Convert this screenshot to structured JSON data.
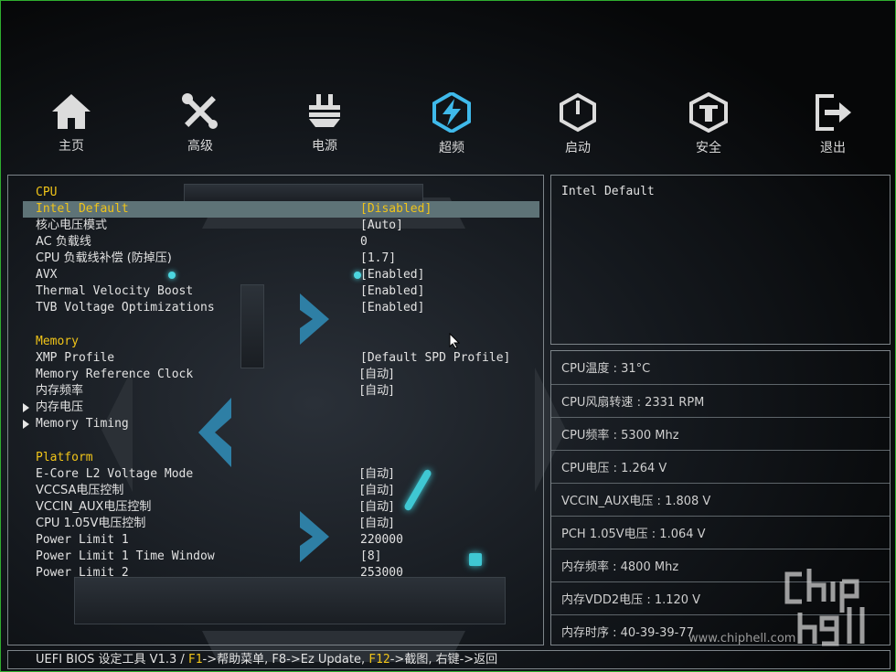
{
  "nav": [
    {
      "label": "主页",
      "icon": "home-icon"
    },
    {
      "label": "高级",
      "icon": "tools-icon"
    },
    {
      "label": "电源",
      "icon": "power-plug-icon"
    },
    {
      "label": "超频",
      "icon": "overclock-bolt-icon"
    },
    {
      "label": "启动",
      "icon": "power-button-icon"
    },
    {
      "label": "安全",
      "icon": "security-shield-icon"
    },
    {
      "label": "退出",
      "icon": "exit-icon"
    }
  ],
  "nav_active_index": 3,
  "settings": {
    "cpu_header": "CPU",
    "cpu": [
      {
        "label": "Intel Default",
        "value": "[Disabled]"
      },
      {
        "label": "核心电压模式",
        "value": "[Auto]"
      },
      {
        "label": "AC 负载线",
        "value": "0"
      },
      {
        "label": "CPU 负载线补偿 (防掉压)",
        "value": "[1.7]"
      },
      {
        "label": "AVX",
        "value": "[Enabled]"
      },
      {
        "label": "Thermal Velocity Boost",
        "value": "[Enabled]"
      },
      {
        "label": "TVB Voltage Optimizations",
        "value": "[Enabled]"
      }
    ],
    "memory_header": "Memory",
    "memory": [
      {
        "label": "XMP Profile",
        "value": "[Default SPD Profile]"
      },
      {
        "label": "Memory Reference Clock",
        "value": "[自动]"
      },
      {
        "label": "内存频率",
        "value": "[自动]"
      },
      {
        "label": "内存电压",
        "value": ""
      },
      {
        "label": "Memory Timing",
        "value": ""
      }
    ],
    "platform_header": "Platform",
    "platform": [
      {
        "label": "E-Core L2 Voltage Mode",
        "value": "[自动]"
      },
      {
        "label": "VCCSA电压控制",
        "value": "[自动]"
      },
      {
        "label": "VCCIN_AUX电压控制",
        "value": "[自动]"
      },
      {
        "label": "CPU 1.05V电压控制",
        "value": "[自动]"
      },
      {
        "label": "Power Limit 1",
        "value": "220000"
      },
      {
        "label": "Power Limit 1 Time Window",
        "value": "[8]"
      },
      {
        "label": "Power Limit 2",
        "value": "253000"
      }
    ]
  },
  "help_text": "Intel Default",
  "status": [
    "CPU温度 : 31°C",
    "CPU风扇转速 : 2331 RPM",
    "CPU频率 : 5300 Mhz",
    "CPU电压 : 1.264 V",
    "VCCIN_AUX电压 : 1.808 V",
    "PCH 1.05V电压 : 1.064 V",
    "内存频率 : 4800 Mhz",
    "内存VDD2电压 : 1.120 V",
    "内存时序 : 40-39-39-77"
  ],
  "bottom": {
    "prefix": "UEFI BIOS 设定工具 V1.3 / ",
    "f1": "F1",
    "f1_text": "->帮助菜单, F8->Ez Update, ",
    "f12": "F12",
    "f12_text": "->截图, 右键->返回"
  },
  "watermark_url": "www.chiphell.com",
  "colors": {
    "highlight": "#f0c419",
    "selected_bg": "#5e7377",
    "accent": "#3fc7d3"
  }
}
